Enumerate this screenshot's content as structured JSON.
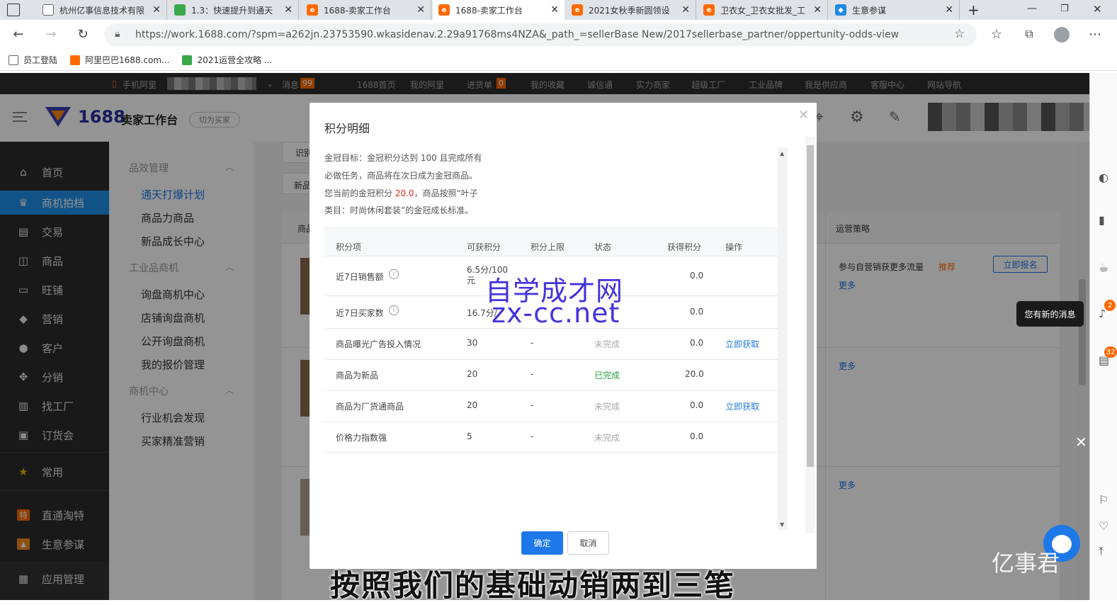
{
  "browser": {
    "tabs": [
      {
        "title": "杭州亿事信息技术有限",
        "icon_color": "#999999",
        "active": false
      },
      {
        "title": "1.3：快速提升到通天",
        "icon_color": "#3aa84a",
        "active": false
      },
      {
        "title": "1688-卖家工作台",
        "icon_color": "#ff6a00",
        "active": false
      },
      {
        "title": "1688-卖家工作台",
        "icon_color": "#ff6a00",
        "active": true
      },
      {
        "title": "2021女秋季新圆领设",
        "icon_color": "#ff6a00",
        "active": false
      },
      {
        "title": "卫衣女_卫衣女批发_工",
        "icon_color": "#ff6a00",
        "active": false
      },
      {
        "title": "生意参谋",
        "icon_color": "#1e88e5",
        "active": false
      }
    ],
    "new_tab": "+",
    "url": "https://work.1688.com/?spm=a262jn.23753590.wkasidenav.2.29a91768ms4NZA&_path_=sellerBase New/2017sellerbase_partner/oppertunity-odds-view",
    "bookmarks": [
      {
        "label": "员工登陆",
        "color": "#666666"
      },
      {
        "label": "阿里巴巴1688.com...",
        "color": "#ff6a00"
      },
      {
        "label": "2021运营全攻略 ...",
        "color": "#3aa84a"
      }
    ]
  },
  "topbar": {
    "mobile": "手机阿里",
    "messages": "消息",
    "messages_count": "99",
    "items": [
      "1688首页",
      "我的阿里",
      "进货单",
      "我的收藏",
      "诚信通",
      "实力商家",
      "超级工厂",
      "工业品牌",
      "我是供应商",
      "客服中心",
      "网站导航"
    ],
    "cart_count": "0"
  },
  "header": {
    "logo_text": "1688",
    "logo_sub": "卖家工作台",
    "switch_btn": "切为买家"
  },
  "sidebar": {
    "items": [
      {
        "label": "首页",
        "icon": "⌂"
      },
      {
        "label": "商机拍档",
        "icon": "♛",
        "active": true
      },
      {
        "label": "交易",
        "icon": "▤"
      },
      {
        "label": "商品",
        "icon": "◫"
      },
      {
        "label": "旺铺",
        "icon": "▭"
      },
      {
        "label": "营销",
        "icon": "◆"
      },
      {
        "label": "客户",
        "icon": "●"
      },
      {
        "label": "分销",
        "icon": "✥"
      },
      {
        "label": "找工厂",
        "icon": "▥"
      },
      {
        "label": "订货会",
        "icon": "▣"
      },
      {
        "label": "常用",
        "icon": "★"
      },
      {
        "label": "直通淘特",
        "icon": "特"
      },
      {
        "label": "生意参谋",
        "icon": "▲"
      },
      {
        "label": "应用管理",
        "icon": "▦"
      }
    ]
  },
  "submenu": {
    "groups": [
      {
        "title": "品效管理",
        "items": [
          "通天打爆计划",
          "商品力商品",
          "新品成长中心"
        ]
      },
      {
        "title": "工业品商机",
        "items": [
          "询盘商机中心",
          "店铺询盘商机",
          "公开询盘商机",
          "我的报价管理"
        ]
      },
      {
        "title": "商机中心",
        "items": [
          "行业机会发现",
          "买家精准营销"
        ]
      }
    ]
  },
  "background": {
    "tab_a": "识别",
    "tab_b": "新品",
    "col_product": "商品",
    "col_strategy": "运营策略",
    "strategy_text": "参与自营销获更多流量",
    "strategy_tag": "推荐",
    "signup_btn": "立即报名",
    "more": "更多",
    "new_msg": "您有新的消息",
    "badge1": "2",
    "badge2": "32"
  },
  "modal": {
    "title": "积分明细",
    "desc_line1": "金冠目标：金冠积分达到 100 且完成所有",
    "desc_line2": "必做任务，商品将在次日成为金冠商品。",
    "desc_line3_a": "您当前的金冠积分",
    "desc_line3_score": "20.0",
    "desc_line3_b": "，商品按照“叶子",
    "desc_line4": "类目：时尚休闲套装”的金冠成长标准。",
    "headers": [
      "积分项",
      "可获积分",
      "积分上限",
      "状态",
      "获得积分",
      "操作"
    ],
    "rows": [
      {
        "item": "近7日销售额",
        "info": true,
        "points": "6.5分/100元",
        "limit": "",
        "status": "",
        "earned": "0.0",
        "action": ""
      },
      {
        "item": "近7日买家数",
        "info": true,
        "points": "16.7分/",
        "limit": "",
        "status": "",
        "earned": "0.0",
        "action": ""
      },
      {
        "item": "商品曝光广告投入情况",
        "info": false,
        "points": "30",
        "limit": "-",
        "status": "未完成",
        "earned": "0.0",
        "action": "立即获取"
      },
      {
        "item": "商品为新品",
        "info": false,
        "points": "20",
        "limit": "-",
        "status": "已完成",
        "earned": "20.0",
        "action": ""
      },
      {
        "item": "商品为厂货通商品",
        "info": false,
        "points": "20",
        "limit": "-",
        "status": "未完成",
        "earned": "0.0",
        "action": "立即获取"
      },
      {
        "item": "价格力指数强",
        "info": false,
        "points": "5",
        "limit": "-",
        "status": "未完成",
        "earned": "0.0",
        "action": ""
      }
    ],
    "ok": "确定",
    "cancel": "取消"
  },
  "watermark": {
    "line1": "自学成才网",
    "line2": "zx-cc.net",
    "brand": "亿事君"
  },
  "subtitle": "按照我们的基础动销两到三笔"
}
